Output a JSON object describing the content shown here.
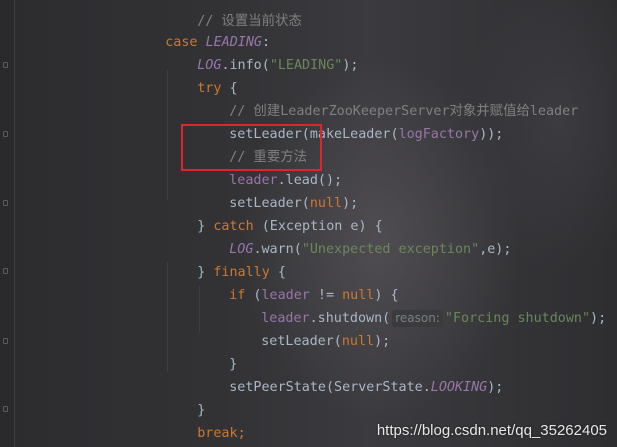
{
  "code": {
    "top_comment": "// 设置当前状态",
    "case_kw": "case",
    "case_label": "LEADING",
    "case_colon": ":",
    "log_const": "LOG",
    "info_call": ".info(",
    "leading_str": "\"LEADING\"",
    "close_paren_semi": ");",
    "try_kw": "try",
    "open_brace": " {",
    "comment_create": "// 创建LeaderZooKeeperServer对象并赋值给leader",
    "set_leader_make": "setLeader(makeLeader(",
    "log_factory": "logFactory",
    "close_double_semi": "));",
    "comment_important": "// 重要方法",
    "leader_field": "leader",
    "lead_call": ".lead();",
    "set_leader_open": "setLeader(",
    "null_kw": "null",
    "close_brace": "}",
    "catch_kw": "catch",
    "catch_param": " (Exception e) {",
    "warn_call": ".warn(",
    "unexpected_str": "\"Unexpected exception\"",
    "warn_tail": ",e);",
    "finally_kw": "finally",
    "if_kw": "if",
    "if_open": " (",
    "neq": " != ",
    "if_close": ") {",
    "shutdown_call": ".shutdown(",
    "param_hint": "reason:",
    "forcing_str": "\"Forcing shutdown\"",
    "set_peer_state": "setPeerState(ServerState.",
    "looking_const": "LOOKING",
    "break_kw": "break",
    "semicolon": ";"
  },
  "watermark": "https://blog.csdn.net/qq_35262405",
  "colors": {
    "keyword": "#cc7832",
    "constant": "#9876aa",
    "string": "#6a8759",
    "comment": "#808080",
    "highlight_border": "#e0242c"
  }
}
